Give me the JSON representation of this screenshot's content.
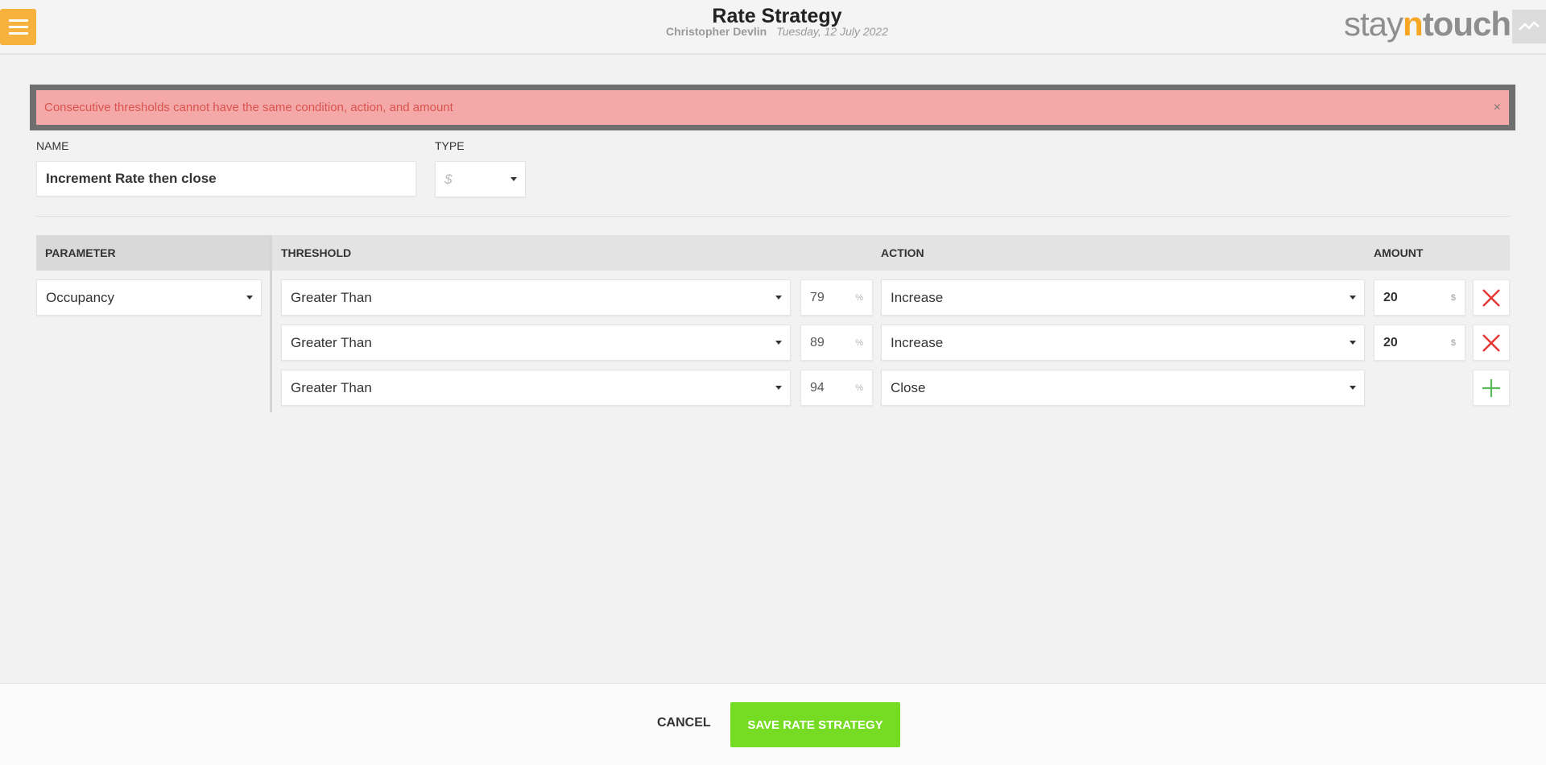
{
  "header": {
    "title": "Rate Strategy",
    "user": "Christopher Devlin",
    "date": "Tuesday, 12 July 2022",
    "logo_stay": "stay",
    "logo_n": "n",
    "logo_touch": "touch",
    "menu_icon": "hamburger-icon",
    "graph_icon": "line-graph-icon"
  },
  "error": {
    "message": "Consecutive thresholds cannot have the same condition, action, and amount",
    "close": "×"
  },
  "form": {
    "name_label": "NAME",
    "name_value": "Increment Rate then close",
    "type_label": "TYPE",
    "type_value": "$"
  },
  "table": {
    "headers": {
      "parameter": "PARAMETER",
      "threshold": "THRESHOLD",
      "action": "ACTION",
      "amount": "AMOUNT"
    },
    "parameter": "Occupancy",
    "rows": [
      {
        "condition": "Greater Than",
        "threshold": "79",
        "threshold_unit": "%",
        "action": "Increase",
        "amount": "20",
        "amount_unit": "$",
        "button": "remove"
      },
      {
        "condition": "Greater Than",
        "threshold": "89",
        "threshold_unit": "%",
        "action": "Increase",
        "amount": "20",
        "amount_unit": "$",
        "button": "remove"
      },
      {
        "condition": "Greater Than",
        "threshold": "94",
        "threshold_unit": "%",
        "action": "Close",
        "button": "add"
      }
    ]
  },
  "footer": {
    "cancel_label": "CANCEL",
    "save_label": "SAVE RATE STRATEGY"
  },
  "colors": {
    "menu": "#f6b23d",
    "error_bg": "#f4a9a8",
    "error_text": "#d9534f",
    "remove": "#e53935",
    "add": "#5cb85c",
    "save": "#75db23"
  }
}
